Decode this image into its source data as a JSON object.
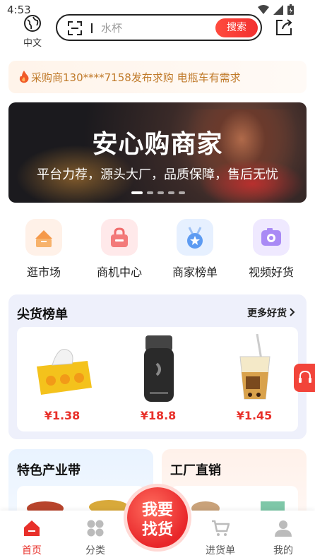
{
  "status": {
    "time": "4:53"
  },
  "header": {
    "language_label": "中文",
    "search_placeholder": "水杯",
    "search_button": "搜索"
  },
  "notice": {
    "text": "采购商130****7158发布求购 电瓶车有需求"
  },
  "banner": {
    "title": "安心购商家",
    "subtitle": "平台力荐，源头大厂，品质保障，售后无忧",
    "slides": 5,
    "active_slide": 1
  },
  "entries": [
    {
      "label": "逛市场",
      "icon": "market-icon",
      "color": "#fff1e8"
    },
    {
      "label": "商机中心",
      "icon": "briefcase-icon",
      "color": "#ffe9ea"
    },
    {
      "label": "商家榜单",
      "icon": "medal-icon",
      "color": "#e6f0ff"
    },
    {
      "label": "视频好货",
      "icon": "camera-icon",
      "color": "#efe9ff"
    }
  ],
  "hot_list": {
    "title": "尖货榜单",
    "more": "更多好货",
    "products": [
      {
        "price": "¥1.38",
        "image": "tissue-pack"
      },
      {
        "price": "¥18.8",
        "image": "electric-shaver"
      },
      {
        "price": "¥1.45",
        "image": "bubble-tea-cup"
      }
    ]
  },
  "sections": [
    {
      "title": "特色产业带"
    },
    {
      "title": "工厂直销"
    }
  ],
  "tabbar": {
    "tabs": [
      {
        "label": "首页",
        "icon": "home-icon",
        "active": true
      },
      {
        "label": "分类",
        "icon": "category-icon",
        "active": false
      },
      {
        "label": "进货单",
        "icon": "cart-icon",
        "active": false
      },
      {
        "label": "我的",
        "icon": "profile-icon",
        "active": false
      }
    ],
    "center_button": {
      "line1": "我要",
      "line2": "找货"
    }
  },
  "colors": {
    "brand_red": "#e8302a",
    "notice_text": "#c07a2a"
  }
}
